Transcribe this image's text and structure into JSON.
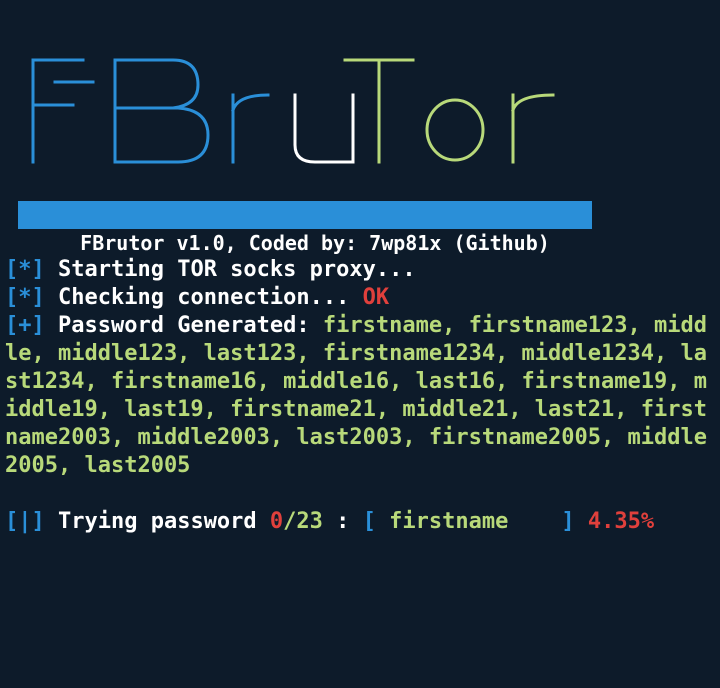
{
  "banner": {
    "left_word": "FBru",
    "right_word": "tor",
    "colors": {
      "left": "#2a8fd8",
      "mid": "#ffffff",
      "right": "#b8d97a"
    }
  },
  "title_bar": {
    "text": "FBrutor v1.0, Coded by: 7wp81x (Github)"
  },
  "output": {
    "line1": {
      "prefix": "[*]",
      "text": " Starting TOR socks proxy..."
    },
    "line2": {
      "prefix": "[*]",
      "text": " Checking connection... ",
      "status": "OK"
    },
    "line3": {
      "prefix": "[+]",
      "label": " Password Generated: ",
      "passwords": "firstname, firstname123, middle, middle123, last123, firstname1234, middle1234, last1234, firstname16, middle16, last16, firstname19, middle19, last19, firstname21, middle21, last21, firstname2003, middle2003, last2003, firstname2005, middle2005, last2005"
    },
    "line4": {
      "prefix": "[|]",
      "label": " Trying password ",
      "current": "0",
      "total": "/23",
      "sep": " : ",
      "open": "[",
      "candidate": " firstname    ",
      "close": "]",
      "percent": " 4.35%"
    }
  }
}
